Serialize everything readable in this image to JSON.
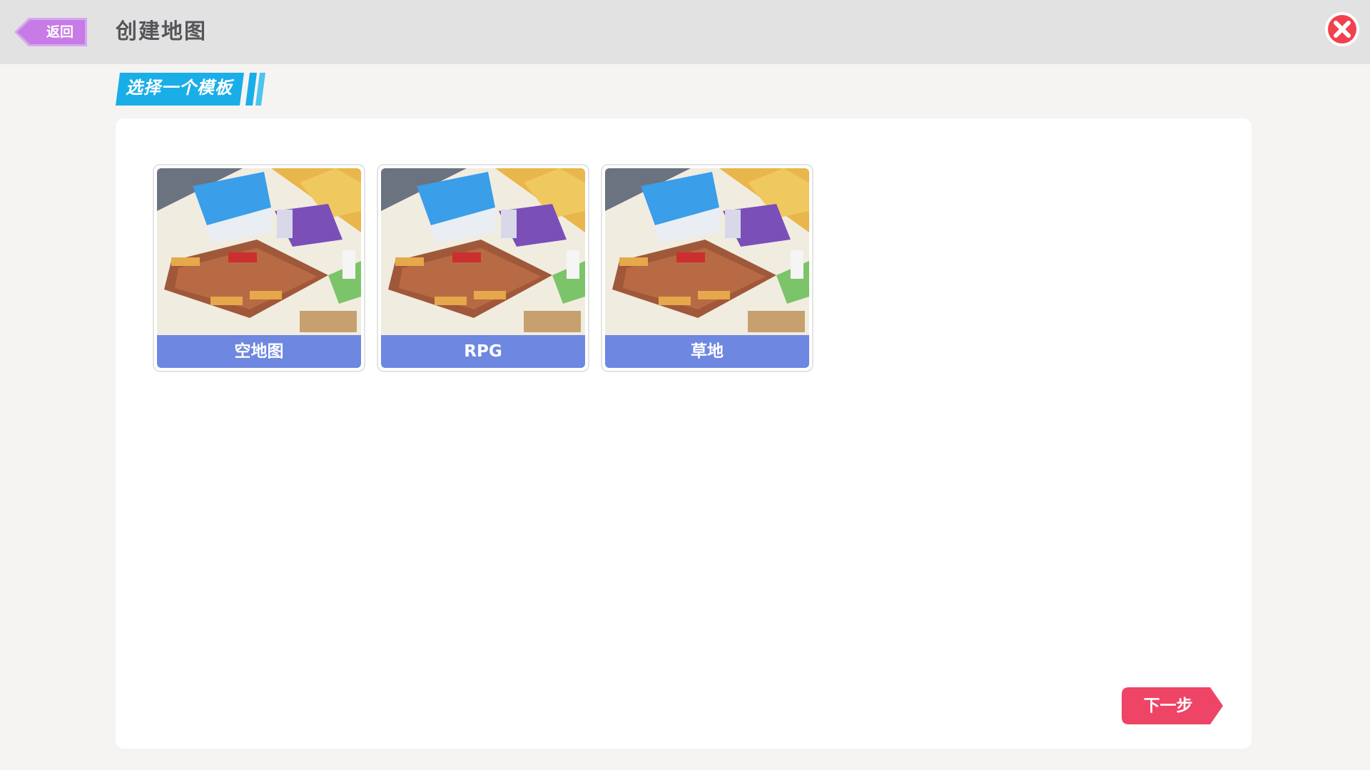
{
  "header": {
    "back_label": "返回",
    "title": "创建地图",
    "close_icon": "close-x-icon"
  },
  "section": {
    "label": "选择一个模板"
  },
  "templates": [
    {
      "label": "空地图"
    },
    {
      "label": "RPG"
    },
    {
      "label": "草地"
    }
  ],
  "footer": {
    "next_label": "下一步"
  },
  "colors": {
    "header_bg": "#e2e2e2",
    "back_button": "#c67be6",
    "close_button": "#f0424d",
    "section_tag": "#1aaee8",
    "label_bar": "#5070e0",
    "next_button": "#ee4466"
  }
}
